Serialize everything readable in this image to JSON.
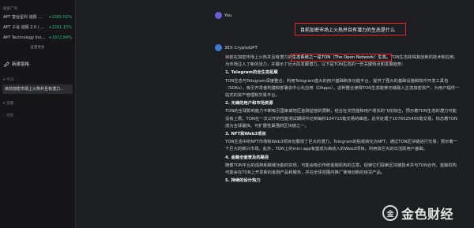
{
  "sidebar": {
    "watchlist_title": "搜索广场",
    "tickers": [
      {
        "name": "APT 智谷星科 谜报 ...",
        "change": "+2265.02%"
      },
      {
        "name": "APT 子会 谜报 2.0 / ...",
        "change": "+2261.15%"
      },
      {
        "name": "APT Technology Inn...",
        "change": "+1972.84%"
      }
    ],
    "view_more": "查看更多",
    "new_chat": "新建窗格",
    "today_label": "今日",
    "history_item": "目前加密市场上火热并且有潜力...",
    "yesterday_label": "近期",
    "older_label": "过往"
  },
  "chat": {
    "user_name": "You",
    "user_question": "目前加密市场上火热并且有潜力的生态是什么",
    "bot_name": "3EX CryptoGPT",
    "answer_intro_a": "目前在加密市场上火热并且有潜力的",
    "answer_intro_mark": "生态系统之一是TON（The Open Network）生态。",
    "answer_intro_b": "TON生态获得其创新的技术和应用，为市场注入了新的活力，并展示了巨大的发展潜力。以下是TON生态的一些关键特点和发展趋势：",
    "s1_title": "1. Telegram的全生态拓展",
    "s1_body": "TON生态与Telegram深度整合，利用Telegram庞大的用户基础和多功能平台，提供了强大的基础设施和软件开发工具包（SDKs），吸引开发者构建和部署去中心化应用（DApps）。这种整合使得TON生态能够无缝融入主流加密资产，为用户提供一站式的资产管理和交易平台。",
    "s2_title": "2. 无缝的用户和市场资源",
    "s2_body": "TON的全球影响能力不断吸引国家或地区金融监管的限制，结合社交性能和用户增长的飞轮效应，预示着TON生态的潜力可能没有上限。TON在一次公开的性能测试期间中达到每秒104715笔交易的峰值，总共处理了1076525455笔交易，标志着TON成为全球最快、可扩展性最强的区块链之一。",
    "s3_title": "3. NFT和Web3项目",
    "s3_body": "TON生态中的NFT市场和Web3项目也展现了巨大的潜力。Telegram的贴纸转化为NFT，通过TON区块链进行交易，预示着一个巨大的新兴市场。此外，TON上的mini app有望成为高收入的Web3项目，利用其巨大的日活跃用户基础。",
    "s4_title": "4. 金融全面普及的路径",
    "s4_body": "随着TON平台的成熟和跨链功能的实现，可能会吸引传统金融机构的注意，促使它们探索区块链技术并与TON合作。金融机构可能会在TON上开发新的金融产品和服务，并在全球范围内推广使用创新的信贷产品。",
    "s5_title": "5. 持续的设计热力"
  },
  "brand": {
    "logo_glyph": "金",
    "logo_text": "金色财经"
  },
  "colors": {
    "highlight_box": "#e3242b",
    "positive": "#2ebd85"
  }
}
